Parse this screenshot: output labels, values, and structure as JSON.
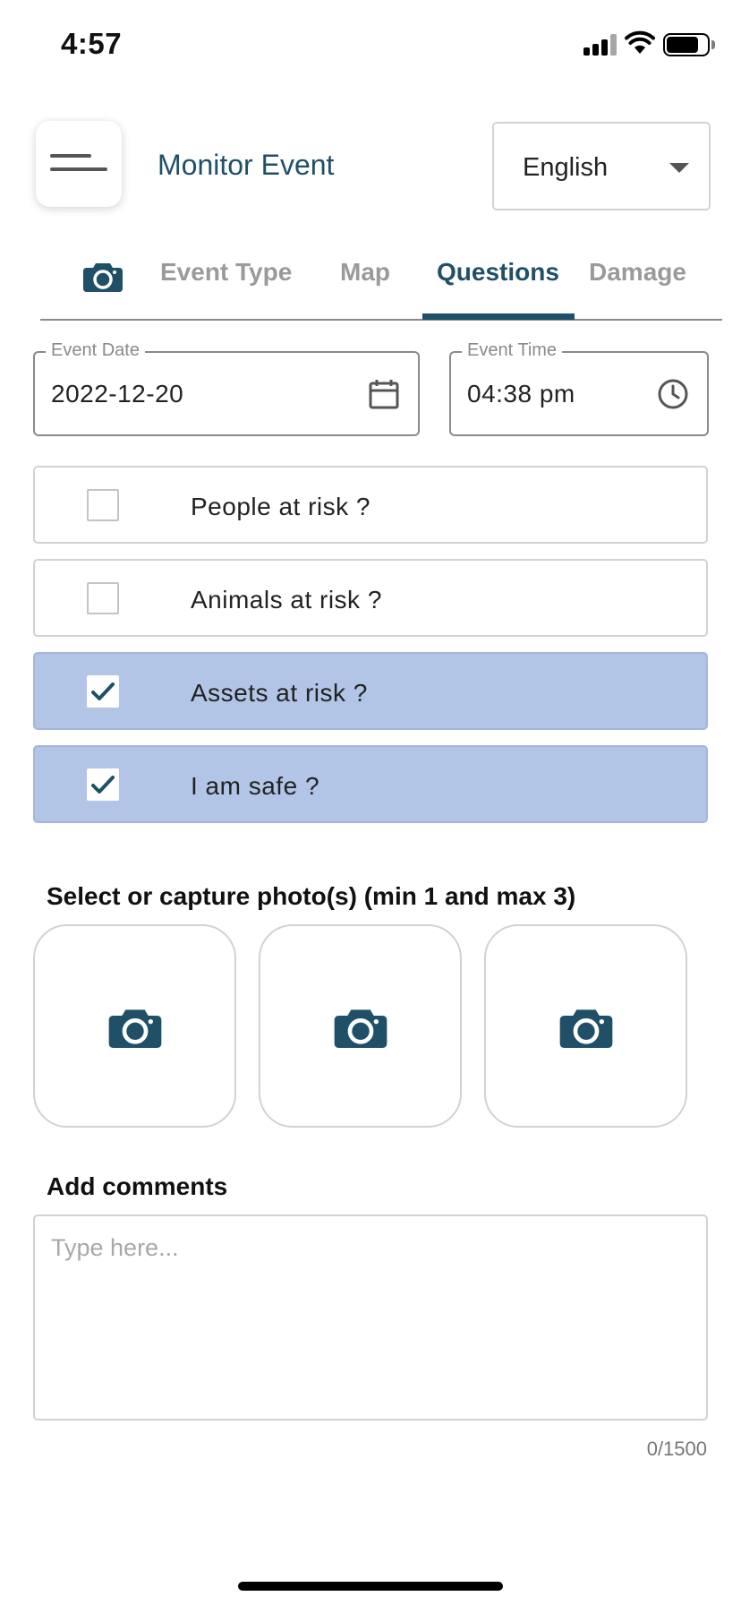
{
  "status_bar": {
    "time": "4:57"
  },
  "header": {
    "title": "Monitor Event",
    "language": "English"
  },
  "tabs": [
    {
      "label": "Event Type",
      "active": false
    },
    {
      "label": "Map",
      "active": false
    },
    {
      "label": "Questions",
      "active": true
    },
    {
      "label": "Damage",
      "active": false
    }
  ],
  "event_date": {
    "label": "Event Date",
    "value": "2022-12-20"
  },
  "event_time": {
    "label": "Event Time",
    "value": "04:38 pm"
  },
  "questions": [
    {
      "label": "People at risk ?",
      "checked": false
    },
    {
      "label": "Animals at risk ?",
      "checked": false
    },
    {
      "label": "Assets at risk ?",
      "checked": true
    },
    {
      "label": "I am safe ?",
      "checked": true
    }
  ],
  "photos": {
    "title": "Select or capture photo(s) (min 1 and max 3)"
  },
  "comments": {
    "title": "Add comments",
    "placeholder": "Type here...",
    "value": "",
    "counter": "0/1500"
  },
  "colors": {
    "accent": "#1f5068",
    "checked_bg": "#b2c5e6",
    "tab_inactive": "#9a9a9a"
  }
}
